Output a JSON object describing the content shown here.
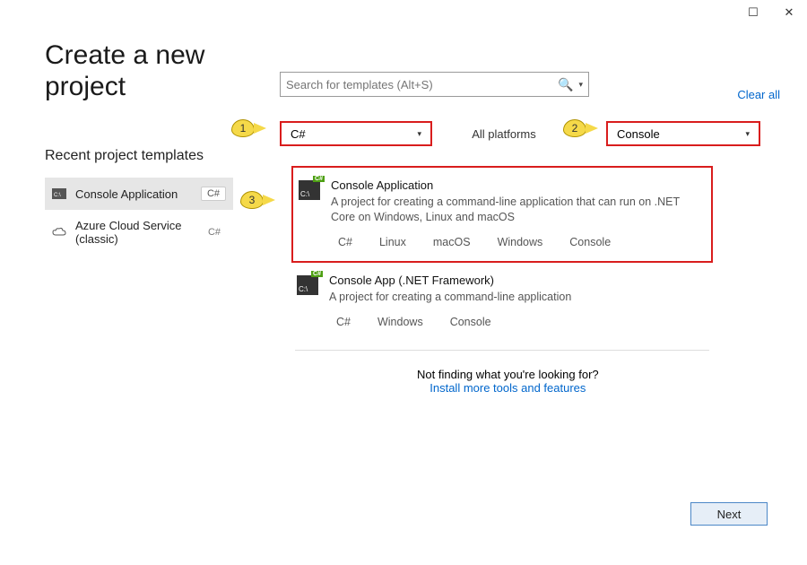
{
  "titlebar": {
    "maximize": "☐",
    "close": "✕"
  },
  "page_title": "Create a new\nproject",
  "recent": {
    "label": "Recent project templates",
    "items": [
      {
        "name": "Console Application",
        "chip": "C#"
      },
      {
        "name": "Azure Cloud Service (classic)",
        "chip": "C#"
      }
    ]
  },
  "search": {
    "placeholder": "Search for templates (Alt+S)"
  },
  "clear_all": "Clear all",
  "filters": {
    "language": "C#",
    "platforms": "All platforms",
    "type": "Console"
  },
  "templates": [
    {
      "title": "Console Application",
      "desc": "A project for creating a command-line application that can run on .NET Core on Windows, Linux and macOS",
      "tags": [
        "C#",
        "Linux",
        "macOS",
        "Windows",
        "Console"
      ]
    },
    {
      "title": "Console App (.NET Framework)",
      "desc": "A project for creating a command-line application",
      "tags": [
        "C#",
        "Windows",
        "Console"
      ]
    }
  ],
  "notfinding": {
    "text": "Not finding what you're looking for?",
    "link": "Install more tools and features"
  },
  "next": "Next",
  "callouts": {
    "c1": "1",
    "c2": "2",
    "c3": "3"
  },
  "icons": {
    "csharp_badge": "C#",
    "console_prompt": "C:\\"
  }
}
